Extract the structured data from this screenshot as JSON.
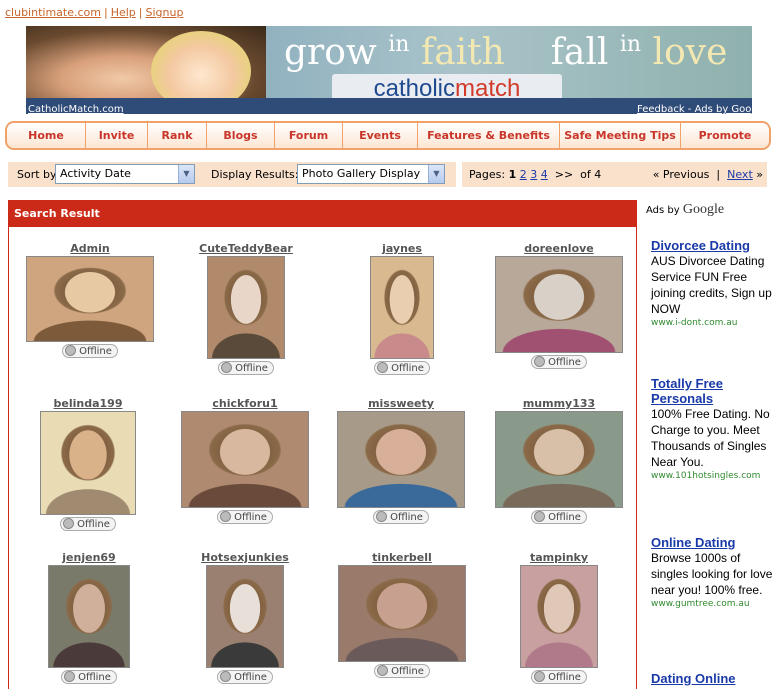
{
  "top_links": [
    "clubintimate.com",
    "Help",
    "Signup"
  ],
  "banner": {
    "slogan_grow": "grow",
    "slogan_in1": "in",
    "slogan_faith": "faith",
    "slogan_fall": "fall",
    "slogan_in2": "in",
    "slogan_love": "love",
    "brand_catholic": "catholic",
    "brand_match": "match",
    "link_left": "CatholicMatch.com",
    "link_right": "Feedback - Ads by Google"
  },
  "nav": [
    "Home",
    "Invite",
    "Rank",
    "Blogs",
    "Forum",
    "Events",
    "Features & Benefits",
    "Safe Meeting Tips",
    "Promote"
  ],
  "controls": {
    "sort_label": "Sort by",
    "sort_value": "Activity Date",
    "display_label": "Display Results:",
    "display_value": "Photo Gallery Display"
  },
  "pager": {
    "pages_label": "Pages:",
    "current": "1",
    "others": [
      "2",
      "3",
      "4"
    ],
    "jump": ">>",
    "of": "of 4",
    "previous": "« Previous",
    "sep": "|",
    "next": "Next",
    "next_arrow": "»"
  },
  "results": {
    "title": "Search Result",
    "status_text": "Offline",
    "members": [
      {
        "name": "Admin",
        "colors": [
          "#cfa580",
          "#e7c9a4",
          "#7d5a3a"
        ]
      },
      {
        "name": "CuteTeddyBear",
        "colors": [
          "#b08a6a",
          "#e8d6c8",
          "#5a4a3a"
        ]
      },
      {
        "name": "jaynes",
        "colors": [
          "#d9b990",
          "#e9cfb0",
          "#c88a8a"
        ]
      },
      {
        "name": "doreenlove",
        "colors": [
          "#b8a89a",
          "#d9d0c8",
          "#a05070"
        ]
      },
      {
        "name": "belinda199",
        "colors": [
          "#e9dcb5",
          "#d9b28a",
          "#a08a70"
        ]
      },
      {
        "name": "chickforu1",
        "colors": [
          "#b08a70",
          "#d9b8a0",
          "#6a4a3a"
        ]
      },
      {
        "name": "missweety",
        "colors": [
          "#a89a88",
          "#d8b09a",
          "#3a6a9a"
        ]
      },
      {
        "name": "mummy133",
        "colors": [
          "#8a9a8a",
          "#d8c0a8",
          "#7a6a5a"
        ]
      },
      {
        "name": "jenjen69",
        "colors": [
          "#7a7a6a",
          "#d0b09a",
          "#4a3a3a"
        ]
      },
      {
        "name": "Hotsexjunkies",
        "colors": [
          "#9a8070",
          "#e8e0d8",
          "#3a3a3a"
        ]
      },
      {
        "name": "tinkerbell",
        "colors": [
          "#9a7a6a",
          "#c8a090",
          "#6a5a5a"
        ]
      },
      {
        "name": "tampinky",
        "colors": [
          "#c8a0a0",
          "#e0c8b8",
          "#b07a8a"
        ]
      }
    ]
  },
  "ads": {
    "ads_by": "Ads by",
    "google": "Google",
    "items": [
      {
        "title": "Divorcee Dating",
        "body": "AUS Divorcee Dating Service FUN Free joining credits, Sign up NOW",
        "url": "www.i-dont.com.au"
      },
      {
        "title": "Totally Free Personals",
        "body": "100% Free Dating. No Charge to you. Meet Thousands of Singles Near You.",
        "url": "www.101hotsingles.com"
      },
      {
        "title": "Online Dating",
        "body": "Browse 1000s of singles looking for love near you! 100% free.",
        "url": "www.gumtree.com.au"
      },
      {
        "title": "Dating Online",
        "body": "",
        "url": ""
      }
    ]
  }
}
